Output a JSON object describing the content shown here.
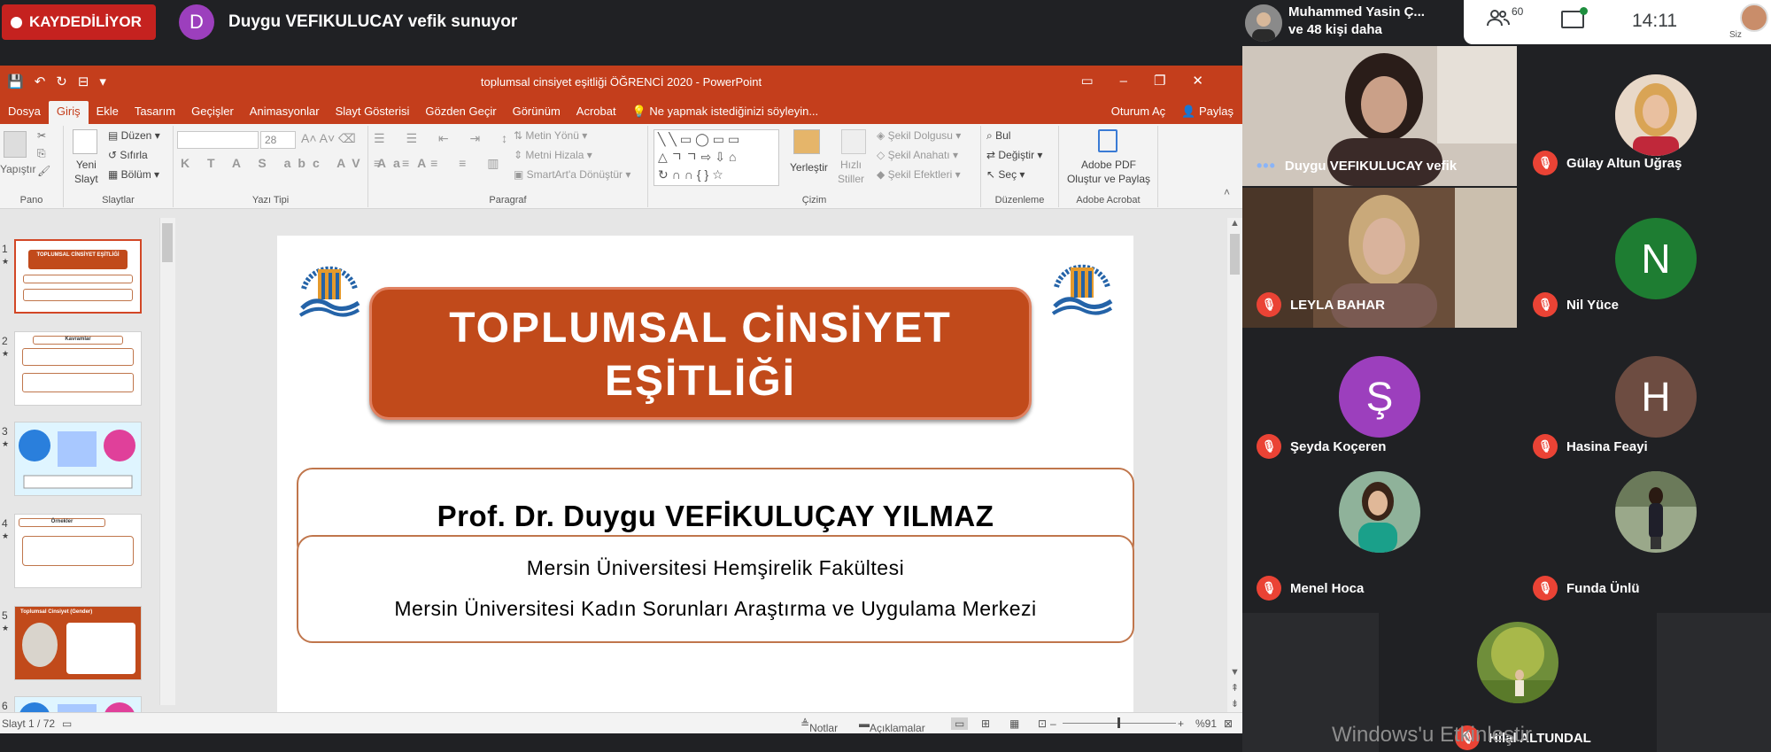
{
  "meet": {
    "recording_label": "KAYDEDİLİYOR",
    "presenter_initial": "D",
    "presenting_text": "Duygu VEFIKULUCAY vefik sunuyor",
    "header_names_line1": "Muhammed Yasin Ç...",
    "header_names_line2": "ve 48 kişi daha",
    "participant_count": "60",
    "clock": "14:11",
    "self_label": "Siz",
    "colors": {
      "record": "#c5221f",
      "background": "#202124",
      "tile": "#3c4043",
      "mic_off": "#ea4335"
    }
  },
  "ppt": {
    "window_title": "toplumsal cinsiyet eşitliği ÖĞRENCİ 2020 - PowerPoint",
    "tabs": [
      "Dosya",
      "Giriş",
      "Ekle",
      "Tasarım",
      "Geçişler",
      "Animasyonlar",
      "Slayt Gösterisi",
      "Gözden Geçir",
      "Görünüm",
      "Acrobat"
    ],
    "selected_tab": "Giriş",
    "tell_me": "Ne yapmak istediğinizi söyleyin...",
    "signin": "Oturum Aç",
    "share": "Paylaş",
    "ribbon": {
      "clipboard_label": "Pano",
      "paste": "Yapıştır",
      "new_slide_line1": "Yeni",
      "new_slide_line2": "Slayt",
      "layout": "Düzen",
      "reset": "Sıfırla",
      "section": "Bölüm",
      "slides_label": "Slaytlar",
      "font_size": "28",
      "font_label": "Yazı Tipi",
      "text_direction": "Metin Yönü",
      "align_text": "Metni Hizala",
      "smartart": "SmartArt'a Dönüştür",
      "paragraph_label": "Paragraf",
      "arrange": "Yerleştir",
      "quick_styles_line1": "Hızlı",
      "quick_styles_line2": "Stiller",
      "shape_fill": "Şekil Dolgusu",
      "shape_outline": "Şekil Anahatı",
      "shape_effects": "Şekil Efektleri",
      "drawing_label": "Çizim",
      "find": "Bul",
      "replace": "Değiştir",
      "select": "Seç",
      "editing_label": "Düzenleme",
      "adobe_line1": "Adobe PDF",
      "adobe_line2": "Oluştur ve Paylaş",
      "adobe_label": "Adobe Acrobat"
    },
    "thumbnails": [
      {
        "num": "1",
        "title": "TOPLUMSAL CİNSİYET EŞİTLİĞİ"
      },
      {
        "num": "2",
        "title": "Kavramlar"
      },
      {
        "num": "3",
        "title": ""
      },
      {
        "num": "4",
        "title": "Örnekler"
      },
      {
        "num": "5",
        "title": "Toplumsal Cinsiyet (Gender)"
      },
      {
        "num": "6",
        "title": ""
      }
    ],
    "slide": {
      "title_line1": "TOPLUMSAL CİNSİYET",
      "title_line2": "EŞİTLİĞİ",
      "author": "Prof. Dr. Duygu VEFİKULUÇAY YILMAZ",
      "affiliation1": "Mersin Üniversitesi Hemşirelik Fakültesi",
      "affiliation2": "Mersin Üniversitesi Kadın Sorunları Araştırma ve Uygulama Merkezi"
    },
    "status": {
      "slide_counter": "Slayt 1 / 72",
      "notes": "Notlar",
      "comments": "Açıklamalar",
      "zoom": "%91"
    }
  },
  "participants": [
    {
      "name": "Duygu VEFIKULUCAY vefik",
      "initial": "",
      "color": "#5a4a45",
      "muted": false,
      "video": true
    },
    {
      "name": "Gülay Altun Uğraş",
      "initial": "",
      "color": "#b0847a",
      "muted": true,
      "video": false
    },
    {
      "name": "LEYLA BAHAR",
      "initial": "",
      "color": "#6b5a4c",
      "muted": true,
      "video": true
    },
    {
      "name": "Nil Yüce",
      "initial": "N",
      "color": "#1e7d32",
      "muted": true,
      "video": false
    },
    {
      "name": "Şeyda Koçeren",
      "initial": "Ş",
      "color": "#9c3fbd",
      "muted": true,
      "video": false
    },
    {
      "name": "Hasina Feayi",
      "initial": "H",
      "color": "#6d4c41",
      "muted": true,
      "video": false
    },
    {
      "name": "Menel Hoca",
      "initial": "",
      "color": "#5f8a7a",
      "muted": true,
      "video": false
    },
    {
      "name": "Funda Ünlü",
      "initial": "",
      "color": "#7b8a6a",
      "muted": true,
      "video": false
    },
    {
      "name": "Hilal ALTUNDAL",
      "initial": "",
      "color": "#7a9a3a",
      "muted": true,
      "video": false
    }
  ],
  "watermark": "Windows'u Etkinleştir"
}
